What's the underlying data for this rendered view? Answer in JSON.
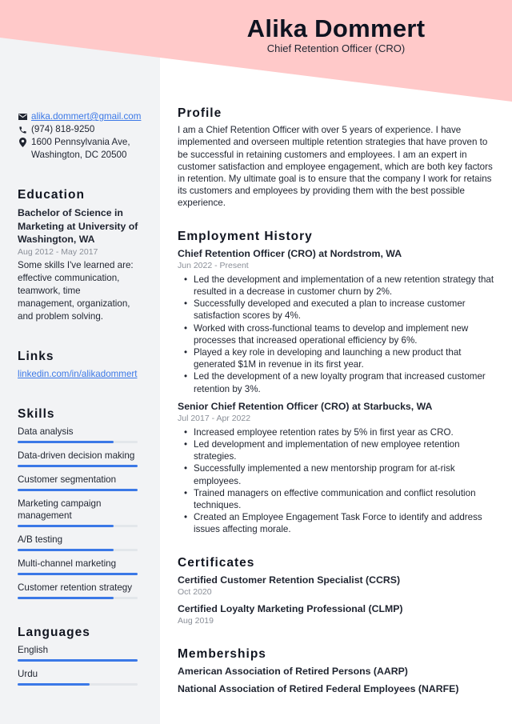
{
  "header": {
    "name": "Alika Dommert",
    "subtitle": "Chief Retention Officer (CRO)",
    "accent_color": "#ffc9c9"
  },
  "sidebar": {
    "contact": {
      "email": "alika.dommert@gmail.com",
      "phone": "(974) 818-9250",
      "address_line1": "1600 Pennsylvania Ave,",
      "address_line2": "Washington, DC 20500"
    },
    "education": {
      "heading": "Education",
      "degree": "Bachelor of Science in Marketing at University of Washington, WA",
      "dates": "Aug 2012 - May 2017",
      "description": "Some skills I've learned are: effective communication, teamwork, time management, organization, and problem solving."
    },
    "links": {
      "heading": "Links",
      "items": [
        {
          "label": "linkedin.com/in/alikadommert"
        }
      ]
    },
    "skills": {
      "heading": "Skills",
      "items": [
        {
          "label": "Data analysis",
          "level_percent": 80
        },
        {
          "label": "Data-driven decision making",
          "level_percent": 100
        },
        {
          "label": "Customer segmentation",
          "level_percent": 100
        },
        {
          "label": "Marketing campaign management",
          "level_percent": 80
        },
        {
          "label": "A/B testing",
          "level_percent": 80
        },
        {
          "label": "Multi-channel marketing",
          "level_percent": 100
        },
        {
          "label": "Customer retention strategy",
          "level_percent": 80
        }
      ]
    },
    "languages": {
      "heading": "Languages",
      "items": [
        {
          "label": "English",
          "level_percent": 100
        },
        {
          "label": "Urdu",
          "level_percent": 60
        }
      ]
    }
  },
  "main": {
    "profile": {
      "heading": "Profile",
      "text": "I am a Chief Retention Officer with over 5 years of experience. I have implemented and overseen multiple retention strategies that have proven to be successful in retaining customers and employees. I am an expert in customer satisfaction and employee engagement, which are both key factors in retention. My ultimate goal is to ensure that the company I work for retains its customers and employees by providing them with the best possible experience."
    },
    "employment": {
      "heading": "Employment History",
      "jobs": [
        {
          "title": "Chief Retention Officer (CRO) at Nordstrom, WA",
          "dates": "Jun 2022 - Present",
          "bullets": [
            "Led the development and implementation of a new retention strategy that resulted in a decrease in customer churn by 2%.",
            "Successfully developed and executed a plan to increase customer satisfaction scores by 4%.",
            "Worked with cross-functional teams to develop and implement new processes that increased operational efficiency by 6%.",
            "Played a key role in developing and launching a new product that generated $1M in revenue in its first year.",
            "Led the development of a new loyalty program that increased customer retention by 3%."
          ]
        },
        {
          "title": "Senior Chief Retention Officer (CRO) at Starbucks, WA",
          "dates": "Jul 2017 - Apr 2022",
          "bullets": [
            "Increased employee retention rates by 5% in first year as CRO.",
            "Led development and implementation of new employee retention strategies.",
            "Successfully implemented a new mentorship program for at-risk employees.",
            "Trained managers on effective communication and conflict resolution techniques.",
            "Created an Employee Engagement Task Force to identify and address issues affecting morale."
          ]
        }
      ]
    },
    "certificates": {
      "heading": "Certificates",
      "items": [
        {
          "title": "Certified Customer Retention Specialist (CCRS)",
          "date": "Oct 2020"
        },
        {
          "title": "Certified Loyalty Marketing Professional (CLMP)",
          "date": "Aug 2019"
        }
      ]
    },
    "memberships": {
      "heading": "Memberships",
      "items": [
        "American Association of Retired Persons (AARP)",
        "National Association of Retired Federal Employees (NARFE)"
      ]
    }
  }
}
